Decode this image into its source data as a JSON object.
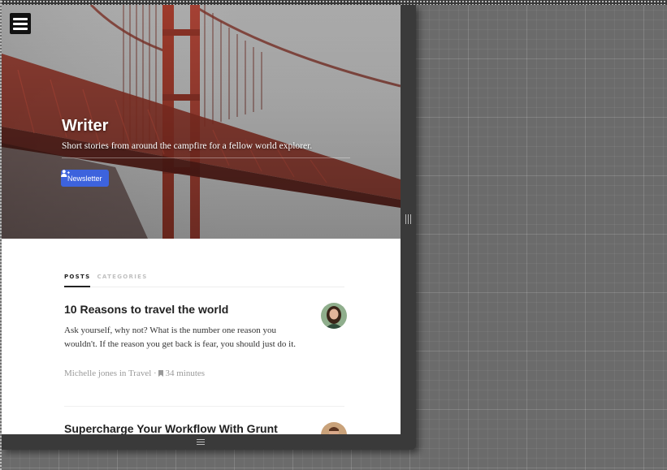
{
  "hero": {
    "title": "Writer",
    "subtitle": "Short stories from around the campfire for a fellow world explorer.",
    "newsletter_label": "Newsletter",
    "newsletter_icon": "user-plus-icon",
    "menu_icon": "hamburger-menu-icon"
  },
  "tabs": [
    {
      "label": "POSTS",
      "active": true
    },
    {
      "label": "CATEGORIES",
      "active": false
    }
  ],
  "posts": [
    {
      "title": "10 Reasons to travel the world",
      "excerpt": "Ask yourself, why not? What is the number one reason you wouldn't. If the reason you get back is fear, you should just do it.",
      "author": "Michelle jones",
      "in": "in",
      "category": "Travel",
      "separator": "·",
      "read_time": "34 minutes",
      "read_time_icon": "bookmark-icon"
    },
    {
      "title": "Supercharge Your Workflow With Grunt"
    }
  ],
  "colors": {
    "accent": "#3d63dd",
    "bridge": "#9e3a2b",
    "frame": "#3a3a3a"
  }
}
